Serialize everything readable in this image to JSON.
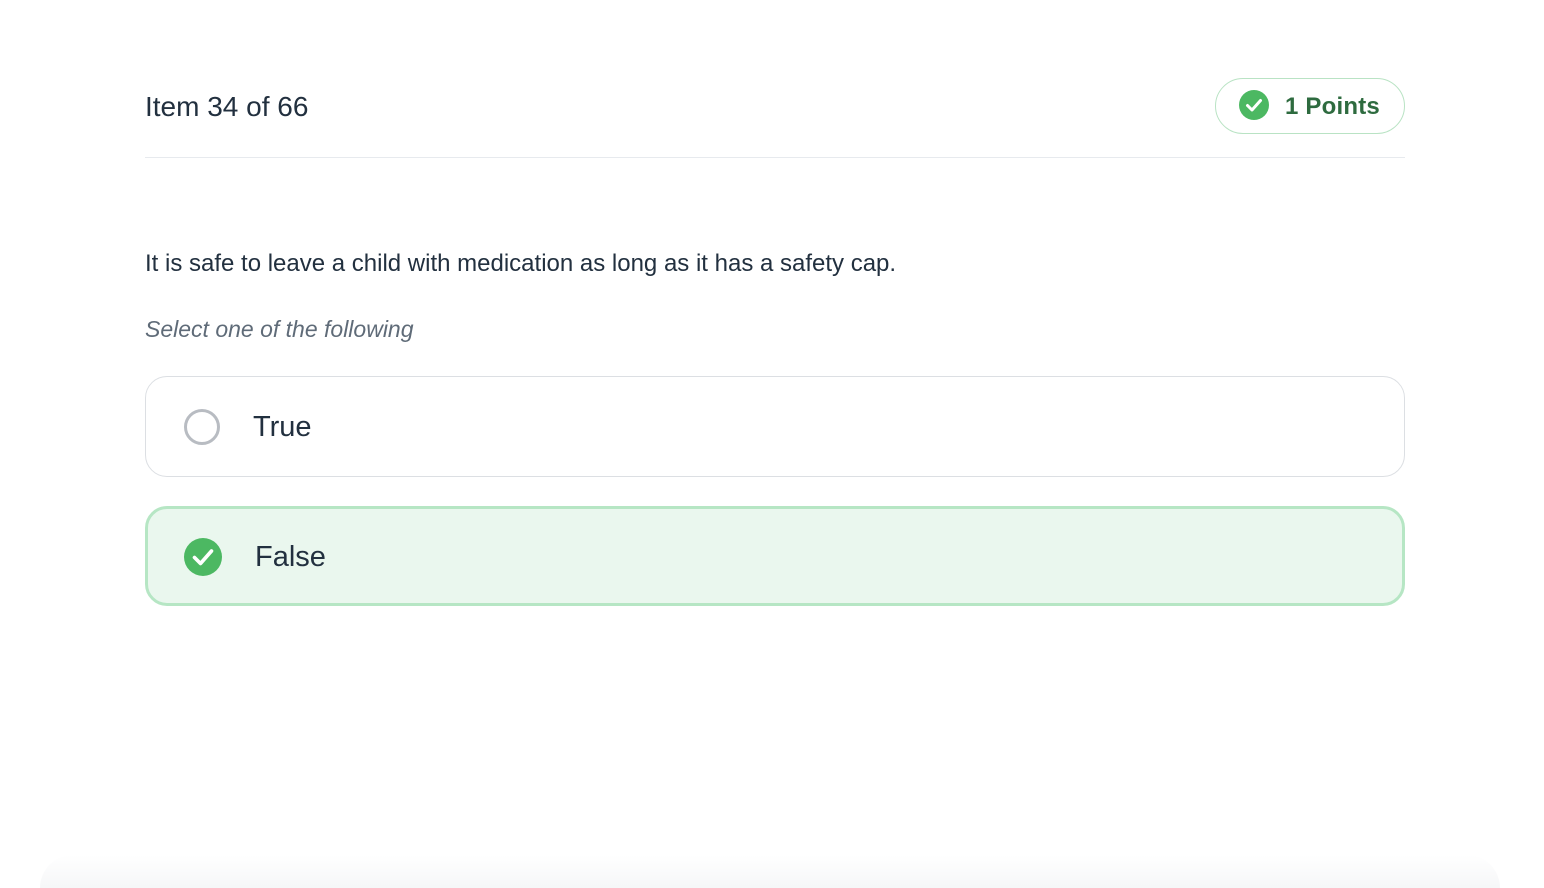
{
  "header": {
    "item_title": "Item 34 of 66",
    "points_label": "1 Points",
    "points_icon": "check-circle-icon"
  },
  "question": {
    "text": "It is safe to leave a child with medication as long as it has a safety cap.",
    "instruction": "Select one of the following"
  },
  "options": [
    {
      "label": "True",
      "selected": false,
      "icon": "radio-empty-icon"
    },
    {
      "label": "False",
      "selected": true,
      "icon": "check-circle-icon"
    }
  ],
  "colors": {
    "accent_green": "#4cb862",
    "selected_bg": "#eaf7ee",
    "selected_border": "#b6e6c4",
    "badge_text": "#2e6b3f",
    "text": "#22303f",
    "muted_text": "#5f6b78"
  }
}
